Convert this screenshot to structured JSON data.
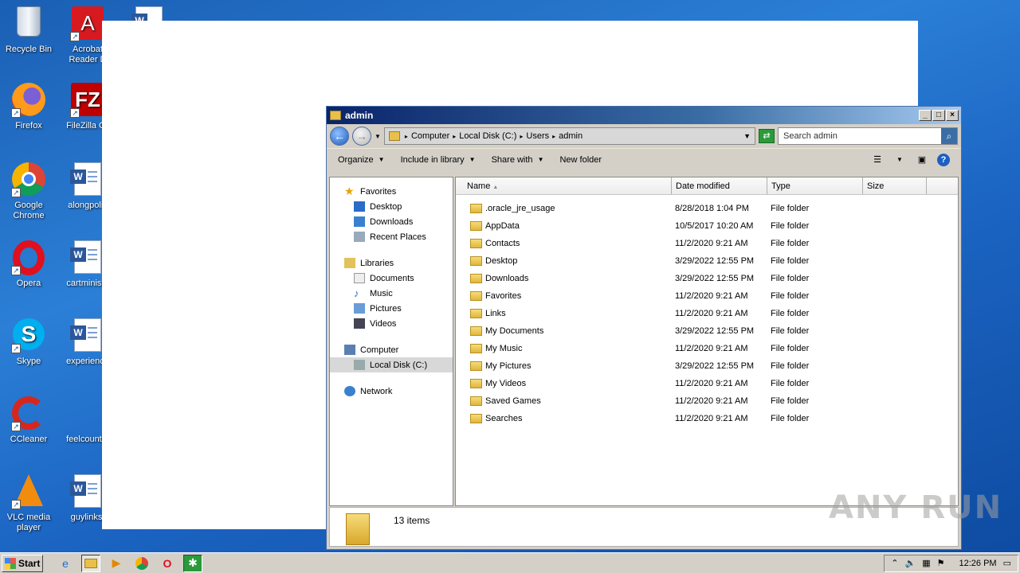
{
  "desktop": {
    "icons": [
      {
        "label": "Recycle Bin"
      },
      {
        "label": "Acrobat Reader D"
      },
      {
        "label": "Firefox"
      },
      {
        "label": "FileZilla Cli"
      },
      {
        "label": "Google Chrome"
      },
      {
        "label": "alongpoliti"
      },
      {
        "label": "Opera"
      },
      {
        "label": "cartministe"
      },
      {
        "label": "Skype"
      },
      {
        "label": "experience"
      },
      {
        "label": "CCleaner"
      },
      {
        "label": "feelcountry"
      },
      {
        "label": "VLC media player"
      },
      {
        "label": "guylinks."
      }
    ]
  },
  "window": {
    "title": "admin",
    "breadcrumb": [
      "Computer",
      "Local Disk (C:)",
      "Users",
      "admin"
    ],
    "search_placeholder": "Search admin",
    "toolbar": {
      "organize": "Organize",
      "include": "Include in library",
      "share": "Share with",
      "new_folder": "New folder"
    },
    "nav": {
      "favorites": "Favorites",
      "desktop": "Desktop",
      "downloads": "Downloads",
      "recent": "Recent Places",
      "libraries": "Libraries",
      "documents": "Documents",
      "music": "Music",
      "pictures": "Pictures",
      "videos": "Videos",
      "computer": "Computer",
      "local_disk": "Local Disk (C:)",
      "network": "Network"
    },
    "columns": {
      "name": "Name",
      "date": "Date modified",
      "type": "Type",
      "size": "Size"
    },
    "files": [
      {
        "name": ".oracle_jre_usage",
        "date": "8/28/2018 1:04 PM",
        "type": "File folder"
      },
      {
        "name": "AppData",
        "date": "10/5/2017 10:20 AM",
        "type": "File folder"
      },
      {
        "name": "Contacts",
        "date": "11/2/2020 9:21 AM",
        "type": "File folder"
      },
      {
        "name": "Desktop",
        "date": "3/29/2022 12:55 PM",
        "type": "File folder"
      },
      {
        "name": "Downloads",
        "date": "3/29/2022 12:55 PM",
        "type": "File folder"
      },
      {
        "name": "Favorites",
        "date": "11/2/2020 9:21 AM",
        "type": "File folder"
      },
      {
        "name": "Links",
        "date": "11/2/2020 9:21 AM",
        "type": "File folder"
      },
      {
        "name": "My Documents",
        "date": "3/29/2022 12:55 PM",
        "type": "File folder"
      },
      {
        "name": "My Music",
        "date": "11/2/2020 9:21 AM",
        "type": "File folder"
      },
      {
        "name": "My Pictures",
        "date": "3/29/2022 12:55 PM",
        "type": "File folder"
      },
      {
        "name": "My Videos",
        "date": "11/2/2020 9:21 AM",
        "type": "File folder"
      },
      {
        "name": "Saved Games",
        "date": "11/2/2020 9:21 AM",
        "type": "File folder"
      },
      {
        "name": "Searches",
        "date": "11/2/2020 9:21 AM",
        "type": "File folder"
      }
    ],
    "status": "13 items"
  },
  "taskbar": {
    "start": "Start",
    "clock": "12:26 PM"
  },
  "watermark": "ANY RUN"
}
